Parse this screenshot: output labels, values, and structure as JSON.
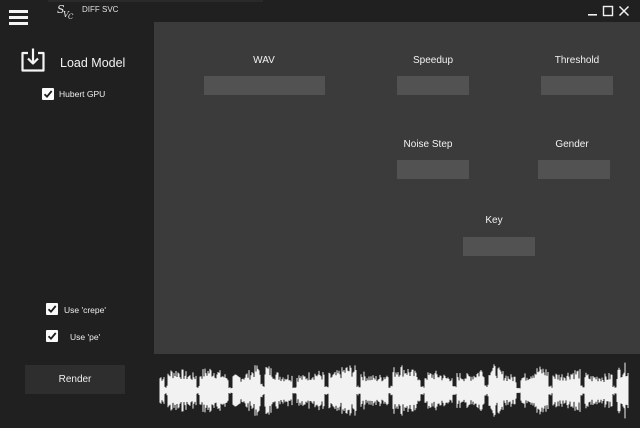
{
  "app": {
    "title": "DIFF SVC",
    "logo_text": "SVC"
  },
  "sidebar": {
    "load_model_label": "Load Model",
    "hubert_gpu_label": "Hubert GPU",
    "hubert_gpu_checked": true,
    "use_crepe_label": "Use 'crepe'",
    "use_crepe_checked": true,
    "use_pe_label": "Use 'pe'",
    "use_pe_checked": true,
    "render_label": "Render"
  },
  "fields": {
    "wav": {
      "label": "WAV",
      "value": ""
    },
    "speedup": {
      "label": "Speedup",
      "value": ""
    },
    "threshold": {
      "label": "Threshold",
      "value": ""
    },
    "noise_step": {
      "label": "Noise Step",
      "value": ""
    },
    "gender": {
      "label": "Gender",
      "value": ""
    },
    "key": {
      "label": "Key",
      "value": ""
    }
  },
  "colors": {
    "background": "#202020",
    "panel": "#3b3b3b",
    "input": "#525252",
    "waveform": "#f2f2f2"
  },
  "icons": {
    "menu": "hamburger-menu-icon",
    "load": "download-tray-icon",
    "minimize": "minimize-icon",
    "maximize": "maximize-icon",
    "close": "close-icon"
  }
}
